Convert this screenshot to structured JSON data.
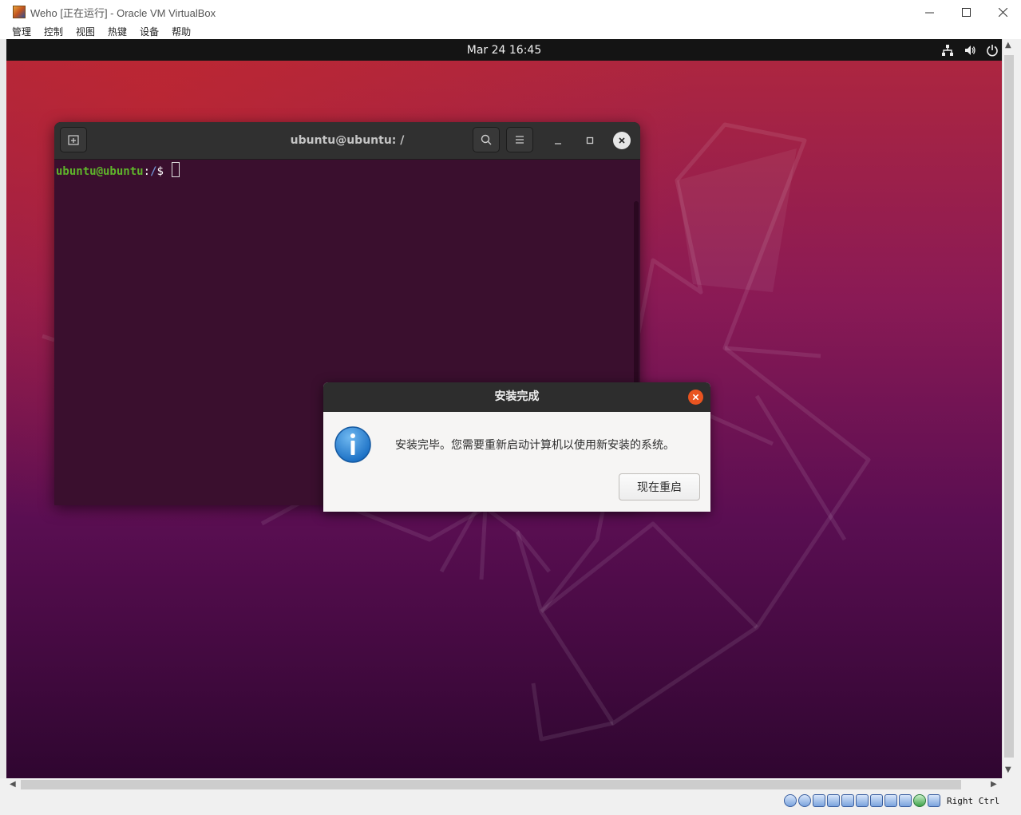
{
  "vbox": {
    "window_title": "Weho [正在运行] - Oracle VM VirtualBox",
    "menu": [
      "管理",
      "控制",
      "视图",
      "热键",
      "设备",
      "帮助"
    ],
    "host_key": "Right Ctrl"
  },
  "guest_topbar": {
    "clock": "Mar 24  16:45"
  },
  "terminal": {
    "title": "ubuntu@ubuntu: /",
    "prompt_user": "ubuntu@ubuntu",
    "prompt_sep": ":",
    "prompt_path": "/",
    "prompt_symbol": "$ "
  },
  "dialog": {
    "title": "安装完成",
    "message": "安装完毕。您需要重新启动计算机以使用新安装的系统。",
    "restart_button": "现在重启"
  },
  "colors": {
    "ubuntu_orange": "#e95420",
    "terminal_bg": "#300a24",
    "prompt_green": "#5fb52b",
    "prompt_blue": "#6f8fcf"
  }
}
